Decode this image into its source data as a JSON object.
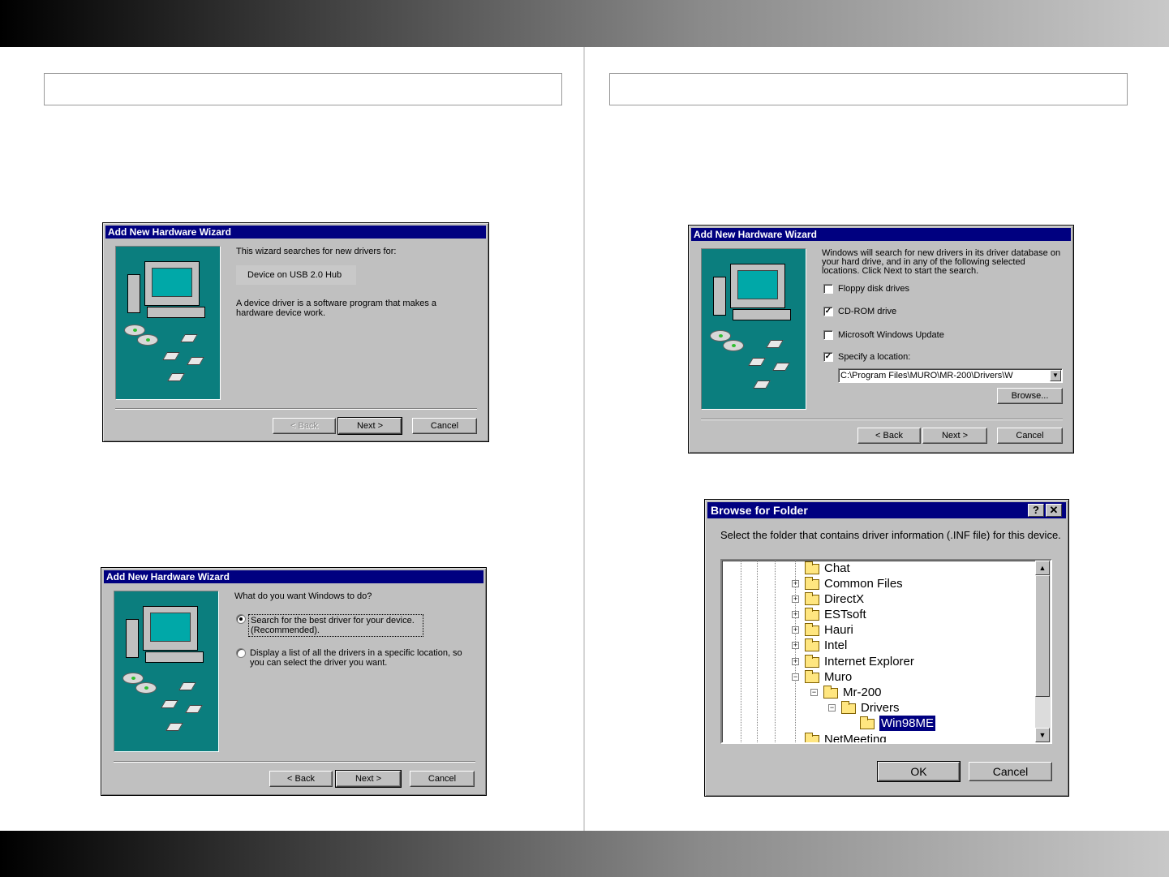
{
  "wizard1": {
    "title": "Add New Hardware Wizard",
    "intro": "This wizard searches for new drivers for:",
    "device": "Device on USB 2.0 Hub",
    "description": "A device driver is a software program that makes a hardware device work.",
    "back": "< Back",
    "next": "Next >",
    "cancel": "Cancel"
  },
  "wizard2": {
    "title": "Add New Hardware Wizard",
    "question": "What do you want Windows to do?",
    "option1": "Search for the best driver for your device. (Recommended).",
    "option2": "Display a list of all the drivers in a specific location, so you can select the driver you want.",
    "back": "< Back",
    "next": "Next >",
    "cancel": "Cancel"
  },
  "wizard3": {
    "title": "Add New Hardware Wizard",
    "intro": "Windows will search for new drivers in its driver database on your hard drive, and in any of the following selected locations. Click Next to start the search.",
    "options": [
      {
        "label": "Floppy disk drives",
        "checked": false
      },
      {
        "label": "CD-ROM drive",
        "checked": true
      },
      {
        "label": "Microsoft Windows Update",
        "checked": false
      },
      {
        "label": "Specify a location:",
        "checked": true
      }
    ],
    "location": "C:\\Program Files\\MURO\\MR-200\\Drivers\\W",
    "browse": "Browse...",
    "back": "< Back",
    "next": "Next >",
    "cancel": "Cancel"
  },
  "browse_dialog": {
    "title": "Browse for Folder",
    "help": "?",
    "close": "✕",
    "instruction": "Select the folder that contains driver information (.INF file) for this device.",
    "folders": [
      "Chat",
      "Common Files",
      "DirectX",
      "ESTsoft",
      "Hauri",
      "Intel",
      "Internet Explorer",
      "Muro",
      "Mr-200",
      "Drivers",
      "Win98ME",
      "NetMeeting"
    ],
    "ok": "OK",
    "cancel": "Cancel"
  }
}
